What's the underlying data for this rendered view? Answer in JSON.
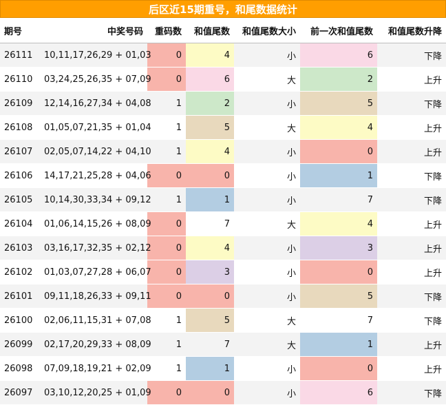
{
  "title": "后区近15期重号，和尾数据统计",
  "headers": [
    "期号",
    "中奖号码",
    "重码数",
    "和值尾数",
    "和值尾数大小",
    "前一次和值尾数",
    "和值尾数升降"
  ],
  "colors": {
    "red": "#f8b4ab",
    "pink": "#fad9e6",
    "yellow": "#fdfbc5",
    "green": "#cde8c9",
    "tan": "#e8d9bd",
    "blue": "#b3cde2",
    "purple": "#dccfe6",
    "header_bg": "#ff9e00"
  },
  "rows": [
    {
      "period": "26111",
      "numbers": "10,11,17,26,29 + 01,03",
      "repeat": "0",
      "tail": "4",
      "size": "小",
      "prev_tail": "6",
      "trend": "下降",
      "repeat_color": "red",
      "tail_color": "yellow",
      "prev_color": "pink"
    },
    {
      "period": "26110",
      "numbers": "03,24,25,26,35 + 07,09",
      "repeat": "0",
      "tail": "6",
      "size": "大",
      "prev_tail": "2",
      "trend": "上升",
      "repeat_color": "red",
      "tail_color": "pink",
      "prev_color": "green"
    },
    {
      "period": "26109",
      "numbers": "12,14,16,27,34 + 04,08",
      "repeat": "1",
      "tail": "2",
      "size": "小",
      "prev_tail": "5",
      "trend": "下降",
      "repeat_color": "plain",
      "tail_color": "green",
      "prev_color": "tan"
    },
    {
      "period": "26108",
      "numbers": "01,05,07,21,35 + 01,04",
      "repeat": "1",
      "tail": "5",
      "size": "大",
      "prev_tail": "4",
      "trend": "上升",
      "repeat_color": "plain",
      "tail_color": "tan",
      "prev_color": "yellow"
    },
    {
      "period": "26107",
      "numbers": "02,05,07,14,22 + 04,10",
      "repeat": "1",
      "tail": "4",
      "size": "小",
      "prev_tail": "0",
      "trend": "上升",
      "repeat_color": "plain",
      "tail_color": "yellow",
      "prev_color": "red"
    },
    {
      "period": "26106",
      "numbers": "14,17,21,25,28 + 04,06",
      "repeat": "0",
      "tail": "0",
      "size": "小",
      "prev_tail": "1",
      "trend": "下降",
      "repeat_color": "red",
      "tail_color": "red",
      "prev_color": "blue"
    },
    {
      "period": "26105",
      "numbers": "10,14,30,33,34 + 09,12",
      "repeat": "1",
      "tail": "1",
      "size": "小",
      "prev_tail": "7",
      "trend": "下降",
      "repeat_color": "plain",
      "tail_color": "blue",
      "prev_color": "plain"
    },
    {
      "period": "26104",
      "numbers": "01,06,14,15,26 + 08,09",
      "repeat": "0",
      "tail": "7",
      "size": "大",
      "prev_tail": "4",
      "trend": "上升",
      "repeat_color": "red",
      "tail_color": "plain",
      "prev_color": "yellow"
    },
    {
      "period": "26103",
      "numbers": "03,16,17,32,35 + 02,12",
      "repeat": "0",
      "tail": "4",
      "size": "小",
      "prev_tail": "3",
      "trend": "上升",
      "repeat_color": "red",
      "tail_color": "yellow",
      "prev_color": "purple"
    },
    {
      "period": "26102",
      "numbers": "01,03,07,27,28 + 06,07",
      "repeat": "0",
      "tail": "3",
      "size": "小",
      "prev_tail": "0",
      "trend": "上升",
      "repeat_color": "red",
      "tail_color": "purple",
      "prev_color": "red"
    },
    {
      "period": "26101",
      "numbers": "09,11,18,26,33 + 09,11",
      "repeat": "0",
      "tail": "0",
      "size": "小",
      "prev_tail": "5",
      "trend": "下降",
      "repeat_color": "red",
      "tail_color": "red",
      "prev_color": "tan"
    },
    {
      "period": "26100",
      "numbers": "02,06,11,15,31 + 07,08",
      "repeat": "1",
      "tail": "5",
      "size": "大",
      "prev_tail": "7",
      "trend": "下降",
      "repeat_color": "plain",
      "tail_color": "tan",
      "prev_color": "plain"
    },
    {
      "period": "26099",
      "numbers": "02,17,20,29,33 + 08,09",
      "repeat": "1",
      "tail": "7",
      "size": "大",
      "prev_tail": "1",
      "trend": "上升",
      "repeat_color": "plain",
      "tail_color": "plain",
      "prev_color": "blue"
    },
    {
      "period": "26098",
      "numbers": "07,09,18,19,21 + 02,09",
      "repeat": "1",
      "tail": "1",
      "size": "小",
      "prev_tail": "0",
      "trend": "上升",
      "repeat_color": "plain",
      "tail_color": "blue",
      "prev_color": "red"
    },
    {
      "period": "26097",
      "numbers": "03,10,12,20,25 + 01,09",
      "repeat": "0",
      "tail": "0",
      "size": "小",
      "prev_tail": "6",
      "trend": "下降",
      "repeat_color": "red",
      "tail_color": "red",
      "prev_color": "pink"
    }
  ]
}
